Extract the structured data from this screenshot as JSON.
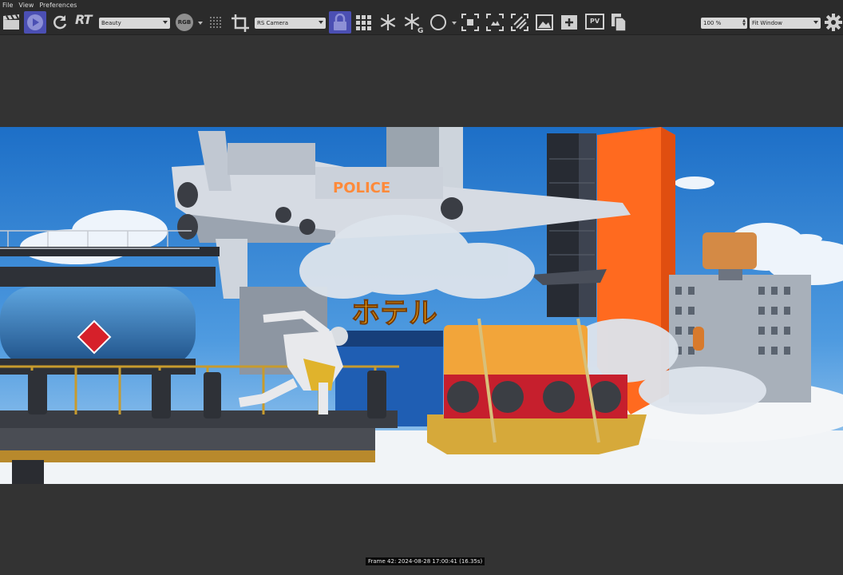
{
  "menu": [
    "File",
    "View",
    "Preferences"
  ],
  "toolbar": {
    "rt_label": "RT",
    "aov_select": "Beauty",
    "rgb_label": "RGB",
    "camera_select": "RS Camera",
    "pv_label": "PV",
    "zoom_value": "100 %",
    "fit_select": "Fit Window",
    "icons": [
      "clapperboard-icon",
      "play-icon",
      "refresh-icon",
      "crop-icon",
      "lock-icon",
      "grid-icon",
      "snowflake-icon",
      "snowflake-g-icon",
      "circle-icon",
      "focus-icon",
      "region-icon",
      "stripes-icon",
      "image-icon",
      "add-image-icon",
      "pv-icon",
      "copy-icon",
      "gear-icon"
    ]
  },
  "render": {
    "sign_police": "POLICE",
    "sign_hotel": "ホテル"
  },
  "status": {
    "frame_info": "Frame 42: 2024-08-28 17:00:41 (16.35s)"
  },
  "colors": {
    "active": "#4b4fb3",
    "panel": "#2b2b2b",
    "viewport": "#333333"
  }
}
